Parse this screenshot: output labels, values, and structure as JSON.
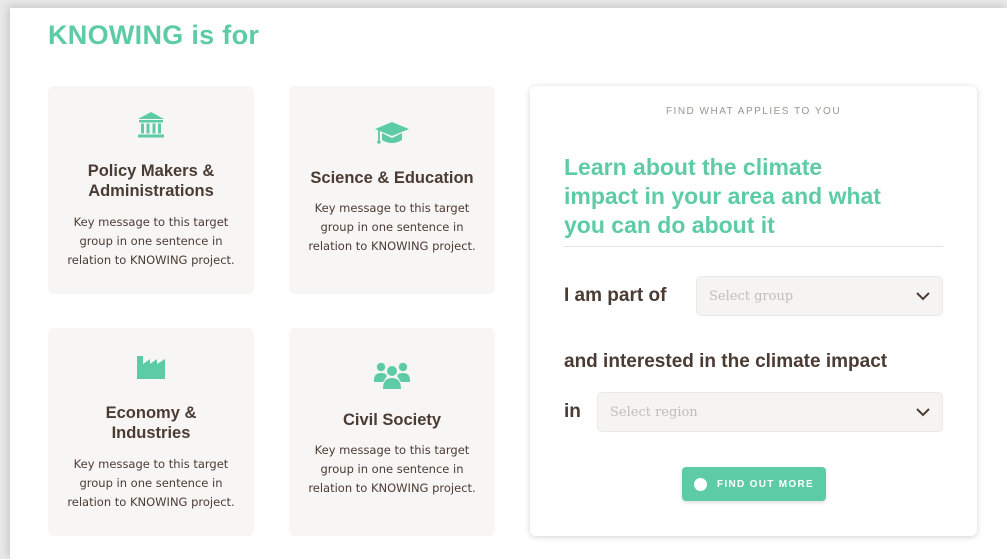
{
  "page": {
    "title": "KNOWING is for"
  },
  "cards": [
    {
      "icon": "institution-icon",
      "title": "Policy Makers & Administrations",
      "title_line1": "Policy Makers &",
      "title_line2": "Administrations",
      "text": "Key message to this target group in one sentence in relation to KNOWING project.",
      "text_line1": "Key message to this target",
      "text_line2": "group in one sentence in",
      "text_line3": "relation to KNOWING project."
    },
    {
      "icon": "graduation-cap-icon",
      "title": "Science & Education",
      "text_line1": "Key message to this target",
      "text_line2": "group in one sentence in",
      "text_line3": "relation to KNOWING project."
    },
    {
      "icon": "factory-icon",
      "title_line1": "Economy &",
      "title_line2": "Industries",
      "text_line1": "Key message to this target",
      "text_line2": "group in one sentence in",
      "text_line3": "relation to KNOWING project."
    },
    {
      "icon": "people-group-icon",
      "title": "Civil Society",
      "text_line1": "Key message to this target",
      "text_line2": "group in one sentence in",
      "text_line3": "relation to KNOWING project."
    }
  ],
  "finder": {
    "overline": "FIND WHAT APPLIES TO YOU",
    "headline_line1": "Learn about the climate",
    "headline_line2": "impact in your area and what",
    "headline_line3": "you can do about it",
    "part_of_label": "I am part of",
    "group_placeholder": "Select group",
    "interested_label": "and interested in the climate impact",
    "in_label": "in",
    "region_placeholder": "Select region",
    "button_label": "FIND OUT MORE",
    "button_icon": "compass-icon"
  },
  "colors": {
    "accent": "#5ecba7",
    "text": "#4a3b33",
    "card_bg": "#f8f6f4"
  }
}
